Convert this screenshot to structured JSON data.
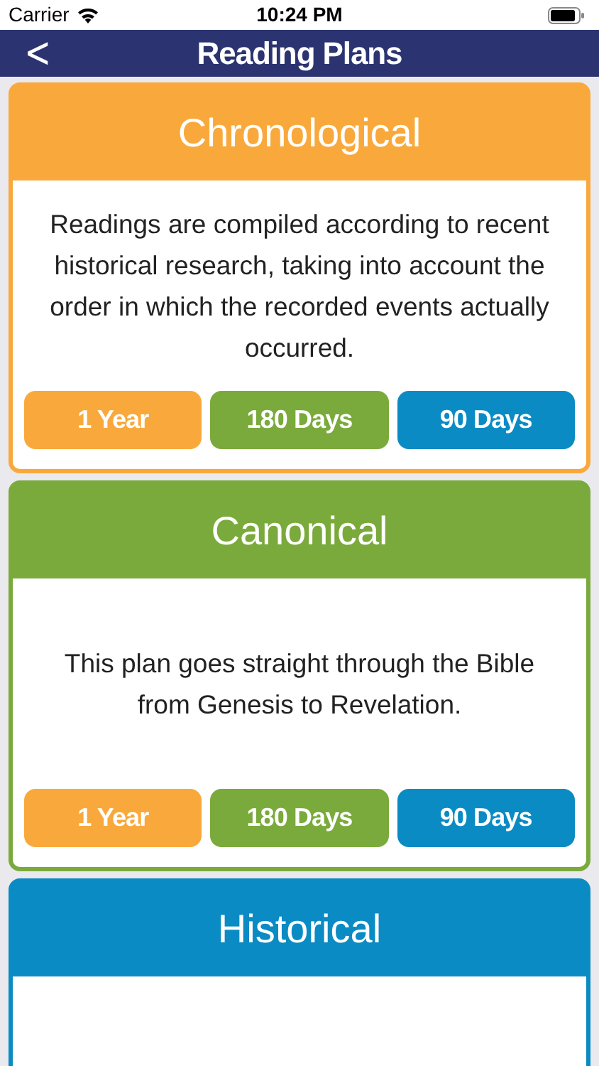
{
  "status_bar": {
    "carrier": "Carrier",
    "time": "10:24 PM"
  },
  "nav_bar": {
    "back": "<",
    "title": "Reading Plans"
  },
  "plans": [
    {
      "title": "Chronological",
      "color": "#f9a93b",
      "description": "Readings are compiled according to recent historical research, taking into account the order in which the recorded events actually occurred.",
      "buttons": [
        {
          "label": "1 Year",
          "color": "#f9a93b"
        },
        {
          "label": "180 Days",
          "color": "#7aaa3b"
        },
        {
          "label": "90 Days",
          "color": "#0a8bc4"
        }
      ]
    },
    {
      "title": "Canonical",
      "color": "#7aaa3b",
      "description": "This plan goes straight through the Bible from Genesis to Revelation.",
      "buttons": [
        {
          "label": "1 Year",
          "color": "#f9a93b"
        },
        {
          "label": "180 Days",
          "color": "#7aaa3b"
        },
        {
          "label": "90 Days",
          "color": "#0a8bc4"
        }
      ]
    },
    {
      "title": "Historical",
      "color": "#0a8bc4"
    }
  ]
}
